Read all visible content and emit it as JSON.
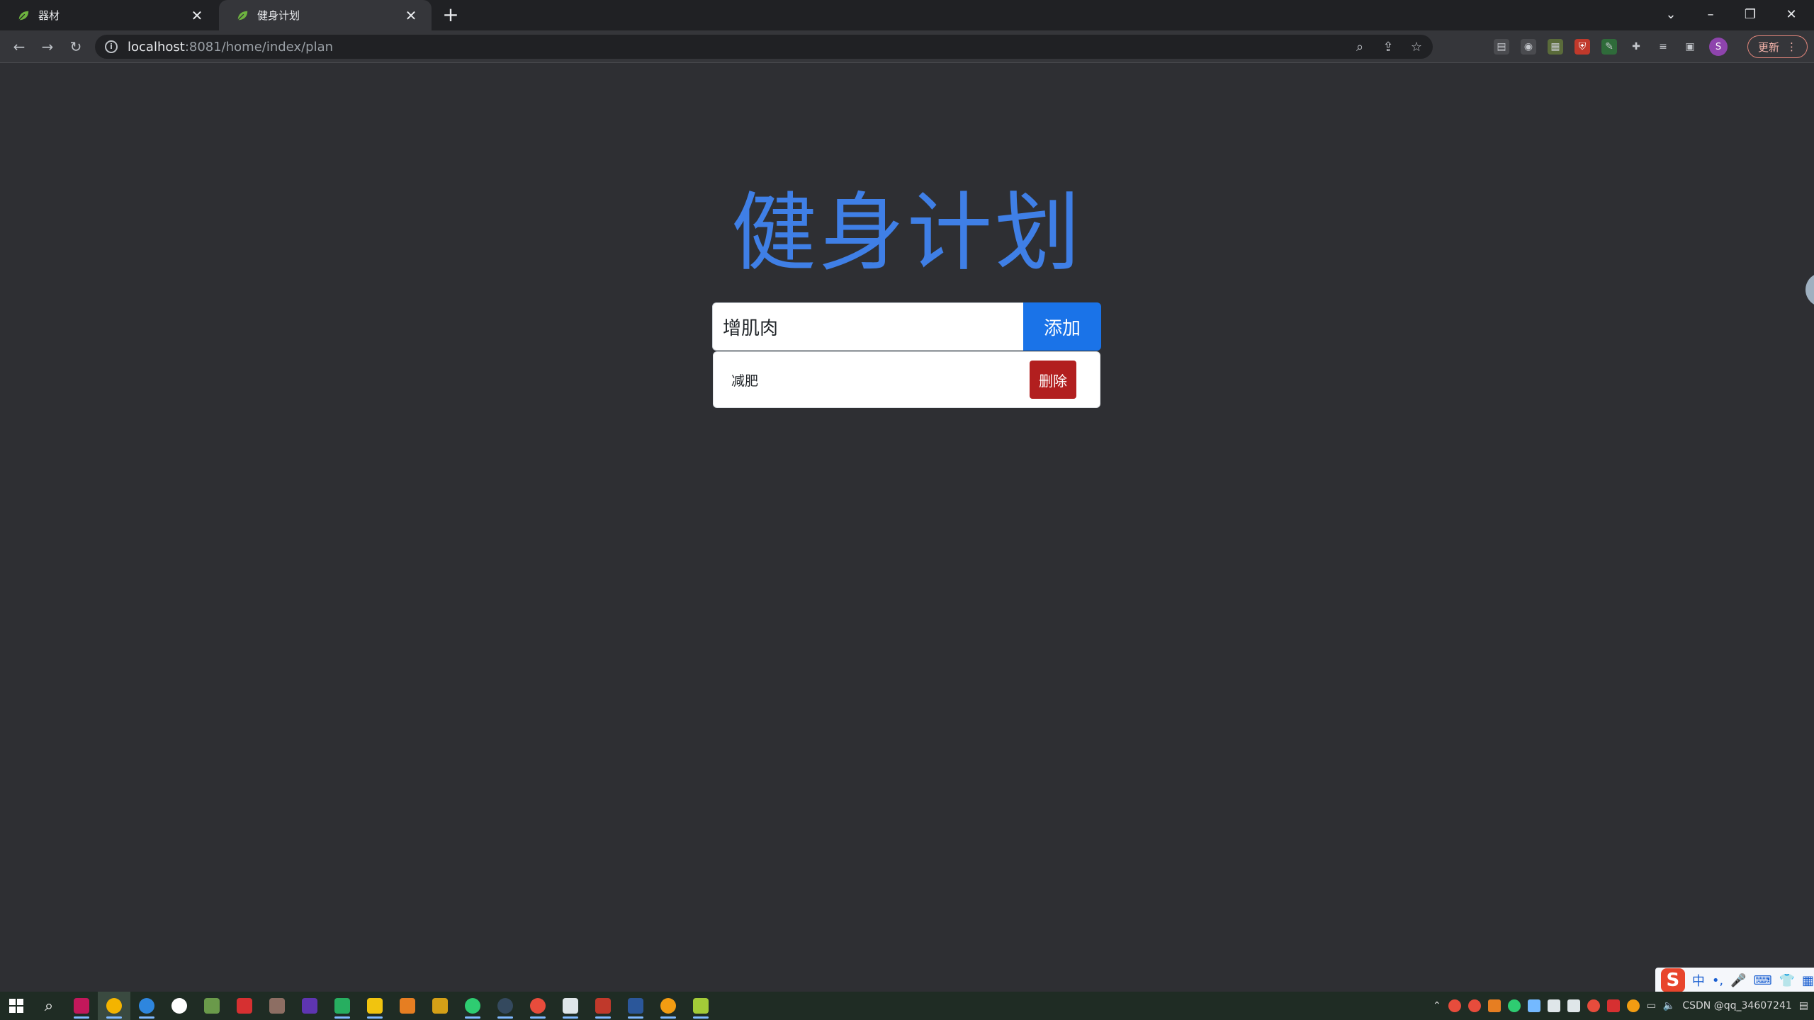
{
  "browser": {
    "tabs": [
      {
        "title": "器材",
        "active": false
      },
      {
        "title": "健身计划",
        "active": true
      }
    ],
    "new_tab_symbol": "+",
    "address": {
      "host": "localhost",
      "path": ":8081/home/index/plan"
    },
    "update_label": "更新",
    "profile_initial": "S"
  },
  "page": {
    "title": "健身计划",
    "input": {
      "value": "增肌肉",
      "placeholder": ""
    },
    "add_label": "添加",
    "plans": [
      {
        "text": "减肥",
        "delete_label": "删除"
      }
    ]
  },
  "taskbar": {
    "ime": {
      "lang": "中"
    },
    "tray_text": "CSDN @qq_34607241"
  },
  "colors": {
    "page_bg": "#2e2f33",
    "title": "#3f7fe6",
    "add_button": "#1a73e8",
    "delete_button": "#b21f1f"
  }
}
